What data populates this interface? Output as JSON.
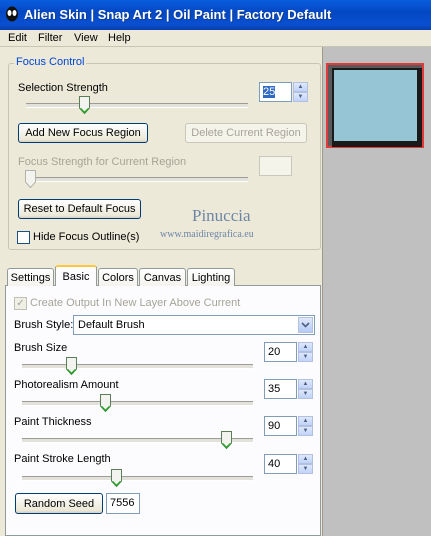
{
  "titlebar": {
    "title": "Alien Skin | Snap Art 2 | Oil Paint | Factory Default"
  },
  "menu": {
    "items": [
      "Edit",
      "Filter",
      "View",
      "Help"
    ]
  },
  "focus_control": {
    "group_label": "Focus Control",
    "selection_strength_label": "Selection Strength",
    "selection_strength_value": "25",
    "add_region_label": "Add New Focus Region",
    "delete_region_label": "Delete Current Region",
    "region_strength_label": "Focus Strength for Current Region",
    "region_strength_value": "",
    "reset_label": "Reset to Default Focus",
    "hide_outline_label": "Hide Focus Outline(s)"
  },
  "watermark": {
    "name": "Pinuccia",
    "url": "www.maidiregrafica.eu"
  },
  "tabs": [
    "Settings",
    "Basic",
    "Colors",
    "Canvas",
    "Lighting"
  ],
  "active_tab": "Basic",
  "basic": {
    "create_output_label": "Create Output In New Layer Above Current",
    "brush_style_label": "Brush Style:",
    "brush_style_value": "Default Brush",
    "brush_size_label": "Brush Size",
    "brush_size_value": "20",
    "photorealism_label": "Photorealism Amount",
    "photorealism_value": "35",
    "paint_thickness_label": "Paint Thickness",
    "paint_thickness_value": "90",
    "stroke_length_label": "Paint Stroke Length",
    "stroke_length_value": "40",
    "random_seed_label": "Random Seed",
    "random_seed_value": "7556"
  },
  "colors": {
    "preview_bg": "#96c6d6",
    "preview_border": "#e03a3a",
    "titlebar": "#0a4fd1",
    "group_label": "#0046d5"
  }
}
